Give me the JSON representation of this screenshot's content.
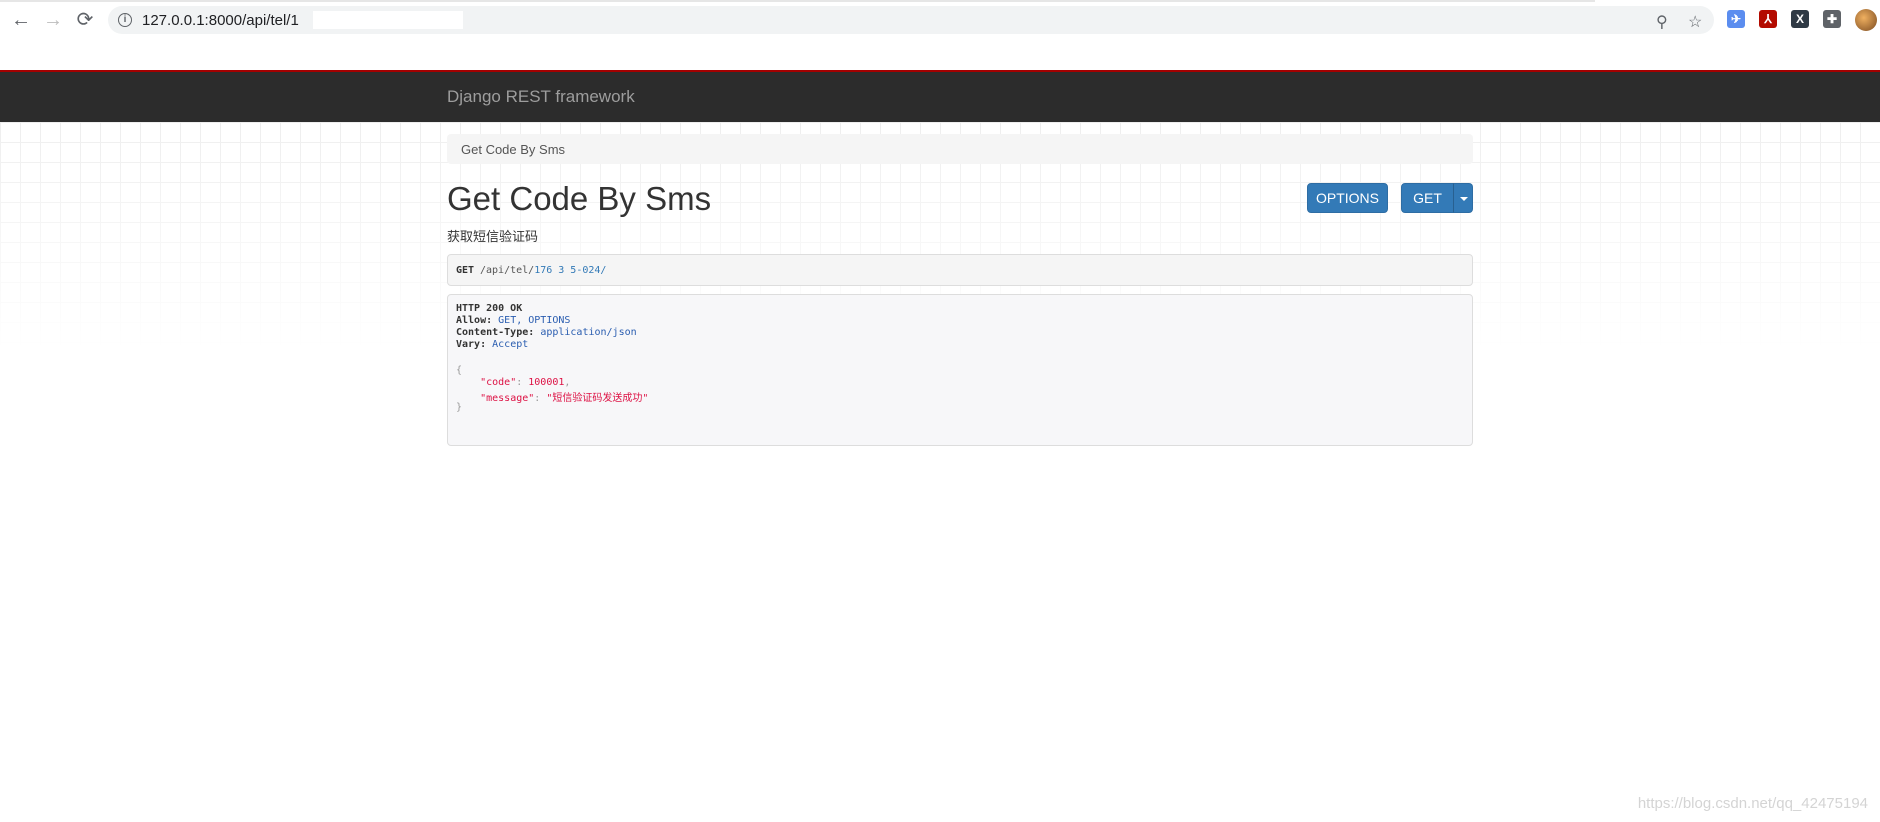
{
  "browser": {
    "url": "127.0.0.1:8000/api/tel/1",
    "back_glyph": "←",
    "forward_glyph": "→",
    "reload_glyph": "⟳",
    "info_glyph": "i",
    "zoom_glyph": "⚲",
    "star_glyph": "☆",
    "extensions": [
      {
        "name": "bird-extension",
        "glyph": "✈",
        "color": "#5b8def"
      },
      {
        "name": "pdf-extension",
        "glyph": "⅄",
        "color": "#b30b00"
      },
      {
        "name": "x-extension",
        "glyph": "X",
        "color": "#2f3a45"
      },
      {
        "name": "puzzle-extension",
        "glyph": "✚",
        "color": "#5f6368"
      }
    ]
  },
  "navbar": {
    "brand": "Django REST framework"
  },
  "breadcrumb": {
    "label": "Get Code By Sms"
  },
  "page": {
    "title": "Get Code By Sms",
    "description": "获取短信验证码"
  },
  "buttons": {
    "options": "OPTIONS",
    "get": "GET"
  },
  "request": {
    "method": "GET",
    "path_prefix": "/api/tel/",
    "path_rest": "176 3 5-024/"
  },
  "response": {
    "status": "HTTP 200 OK",
    "allow_key": "Allow:",
    "allow_val": "GET, OPTIONS",
    "ctype_key": "Content-Type:",
    "ctype_val": "application/json",
    "vary_key": "Vary:",
    "vary_val": "Accept",
    "open_brace": "{",
    "code_key": "\"code\"",
    "code_val": "100001",
    "message_key": "\"message\"",
    "message_val": "\"短信验证码发送成功\"",
    "close_brace": "}"
  },
  "watermark": "https://blog.csdn.net/qq_42475194"
}
